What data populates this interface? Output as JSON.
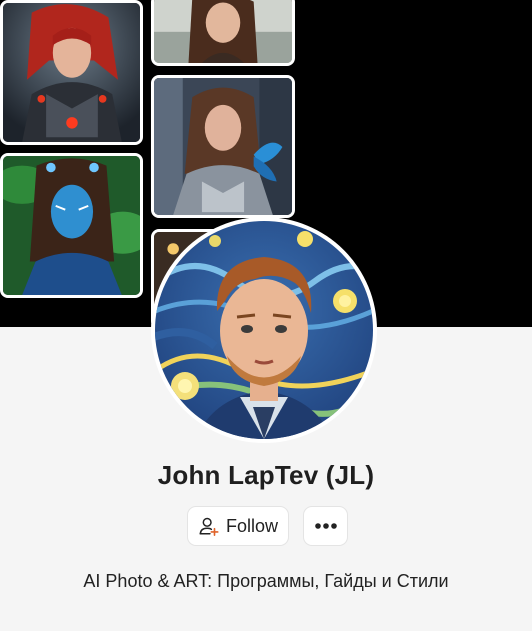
{
  "profile": {
    "name": "John LapTev (JL)",
    "bio": "AI Photo & ART: Программы, Гайды и Стили"
  },
  "actions": {
    "follow_label": "Follow",
    "more_icon": "more-horizontal-icon",
    "follow_icon": "user-add-icon"
  },
  "colors": {
    "cover_background": "#000000",
    "page_background": "#f5f5f5",
    "text": "#1f1f1f",
    "follow_icon_accent": "#e0632a"
  },
  "cover": {
    "images": [
      {
        "subject": "red-haired woman in dark armor"
      },
      {
        "subject": "woman at seaside"
      },
      {
        "subject": "woman in armor with butterfly"
      },
      {
        "subject": "woman with blue face paint in jungle"
      },
      {
        "subject": "partially visible portrait"
      }
    ]
  },
  "avatar": {
    "subject": "man portrait in starry night style"
  }
}
